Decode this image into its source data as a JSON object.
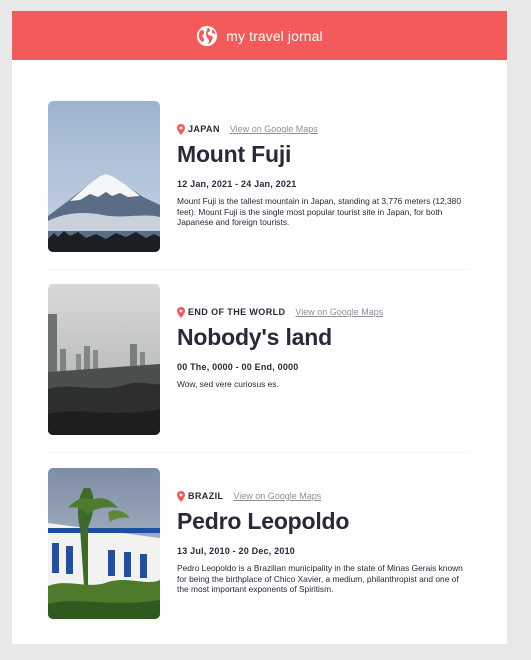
{
  "header": {
    "title": "my travel jornal",
    "icon": "globe-icon",
    "background": "#f55a5a"
  },
  "entries": [
    {
      "country": "JAPAN",
      "maps_link": "View on Google Maps",
      "place": "Mount Fuji",
      "dates": "12 Jan, 2021 - 24 Jan, 2021",
      "description": "Mount Fuji is the tallest mountain in Japan, standing at 3,776 meters (12,380 feet). Mount Fuji is the single most popular tourist site in Japan, for both Japanese and foreign tourists.",
      "photo": "mount-fuji-photo"
    },
    {
      "country": "END OF THE WORLD",
      "maps_link": "View on Google Maps",
      "place": "Nobody's land",
      "dates": "00 The, 0000 - 00 End, 0000",
      "description": "Wow, sed vere curiosus es.",
      "photo": "ruined-city-photo"
    },
    {
      "country": "BRAZIL",
      "maps_link": "View on Google Maps",
      "place": "Pedro Leopoldo",
      "dates": "13 Jul, 2010 - 20 Dec, 2010",
      "description": "Pedro Leopoldo is a Brazilian municipality in the state of Minas Gerais known for being the birthplace of Chico Xavier, a medium, philanthropist and one of the most important exponents of Spiritism.",
      "photo": "pedro-leopoldo-photo"
    }
  ],
  "colors": {
    "accent": "#f55a5a",
    "text": "#2b283a",
    "muted": "#918e9b"
  }
}
